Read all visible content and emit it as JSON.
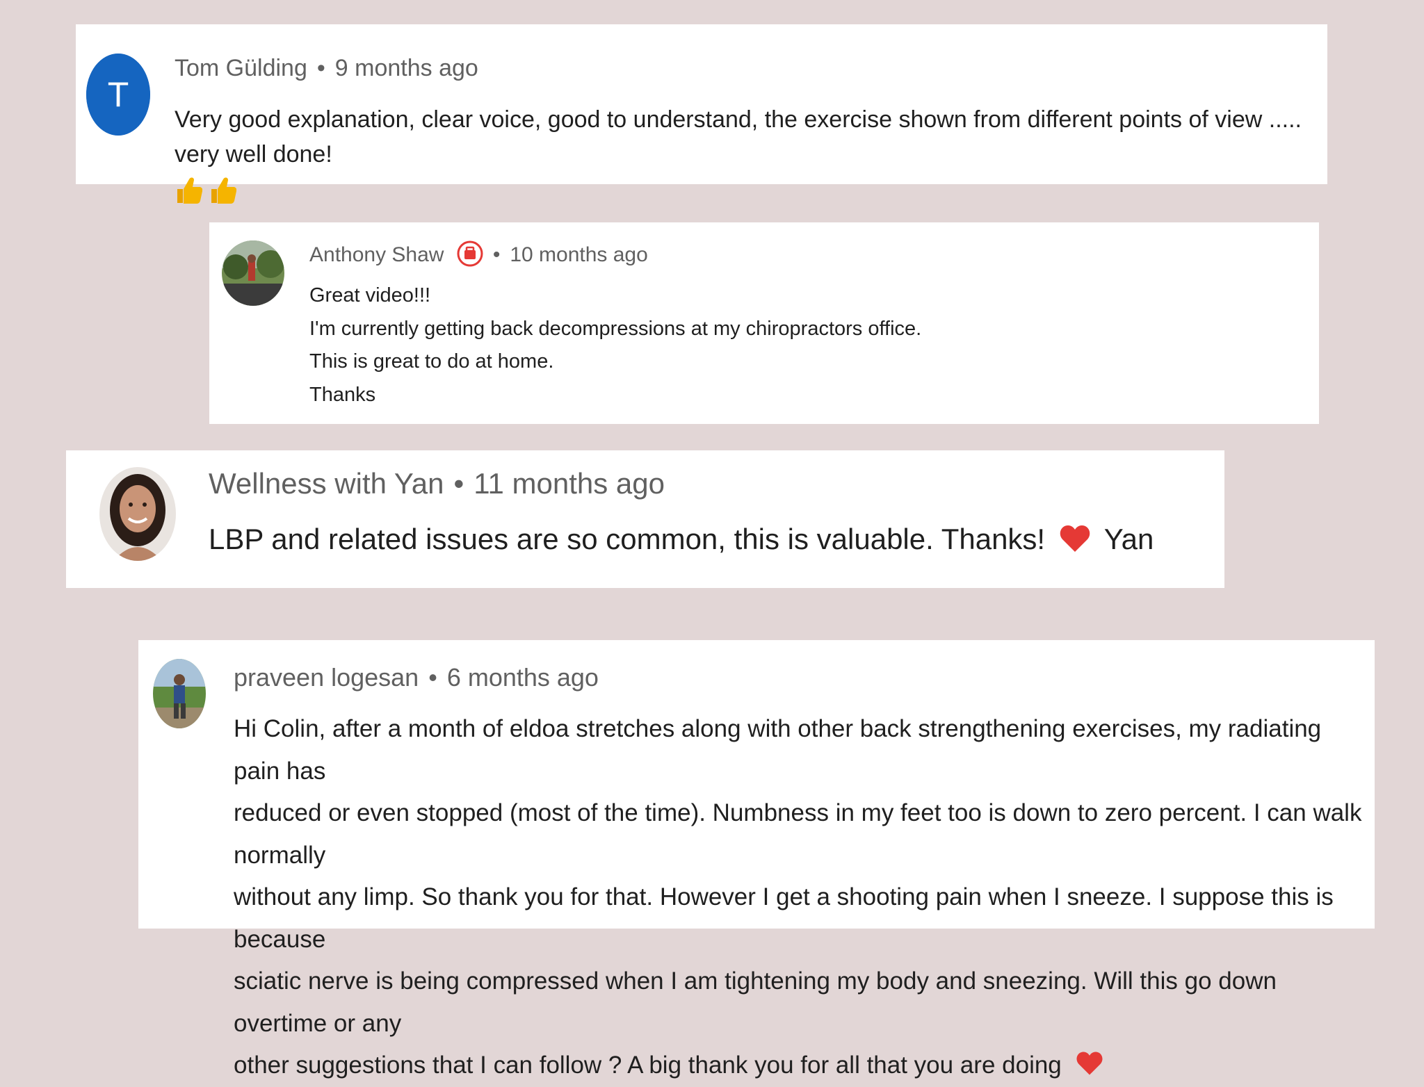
{
  "comments": [
    {
      "author": "Tom Gülding",
      "avatar_letter": "T",
      "avatar_color": "#1565c0",
      "separator": "•",
      "time": "9 months ago",
      "lines": [
        "Very good explanation, clear voice, good to understand, the exercise shown from different points of view ..... very well done!"
      ],
      "emoji": "thumbs-up-icon ×2"
    },
    {
      "author": "Anthony Shaw",
      "badge": "member-badge-icon",
      "separator": "•",
      "time": "10 months ago",
      "lines": [
        "Great video!!!",
        "I'm currently getting back decompressions at my chiropractors office.",
        "This is great to do at home.",
        "Thanks"
      ]
    },
    {
      "author": "Wellness with Yan",
      "separator": "•",
      "time": "11 months ago",
      "text_before": "LBP and related issues are so common, this is valuable. Thanks!",
      "text_after": "Yan",
      "emoji": "heart-icon"
    },
    {
      "author": "praveen logesan",
      "separator": "•",
      "time": "6 months ago",
      "lines": [
        "Hi Colin, after a month of eldoa stretches along with other back strengthening exercises, my radiating pain has",
        "reduced or even stopped (most of the time). Numbness in my feet too is down to zero percent. I can walk normally",
        "without any limp. So thank you for that. However I get a shooting pain when I sneeze. I suppose this is because",
        "sciatic nerve is being compressed when I am tightening my body and sneezing. Will this go down overtime or any",
        "other suggestions that I can follow ? A big thank you for all that you are doing"
      ],
      "emoji": "heart-icon"
    }
  ],
  "colors": {
    "background": "#e2d6d6",
    "heart": "#e53935",
    "thumb": "#f5b400",
    "badge": "#e53935"
  }
}
